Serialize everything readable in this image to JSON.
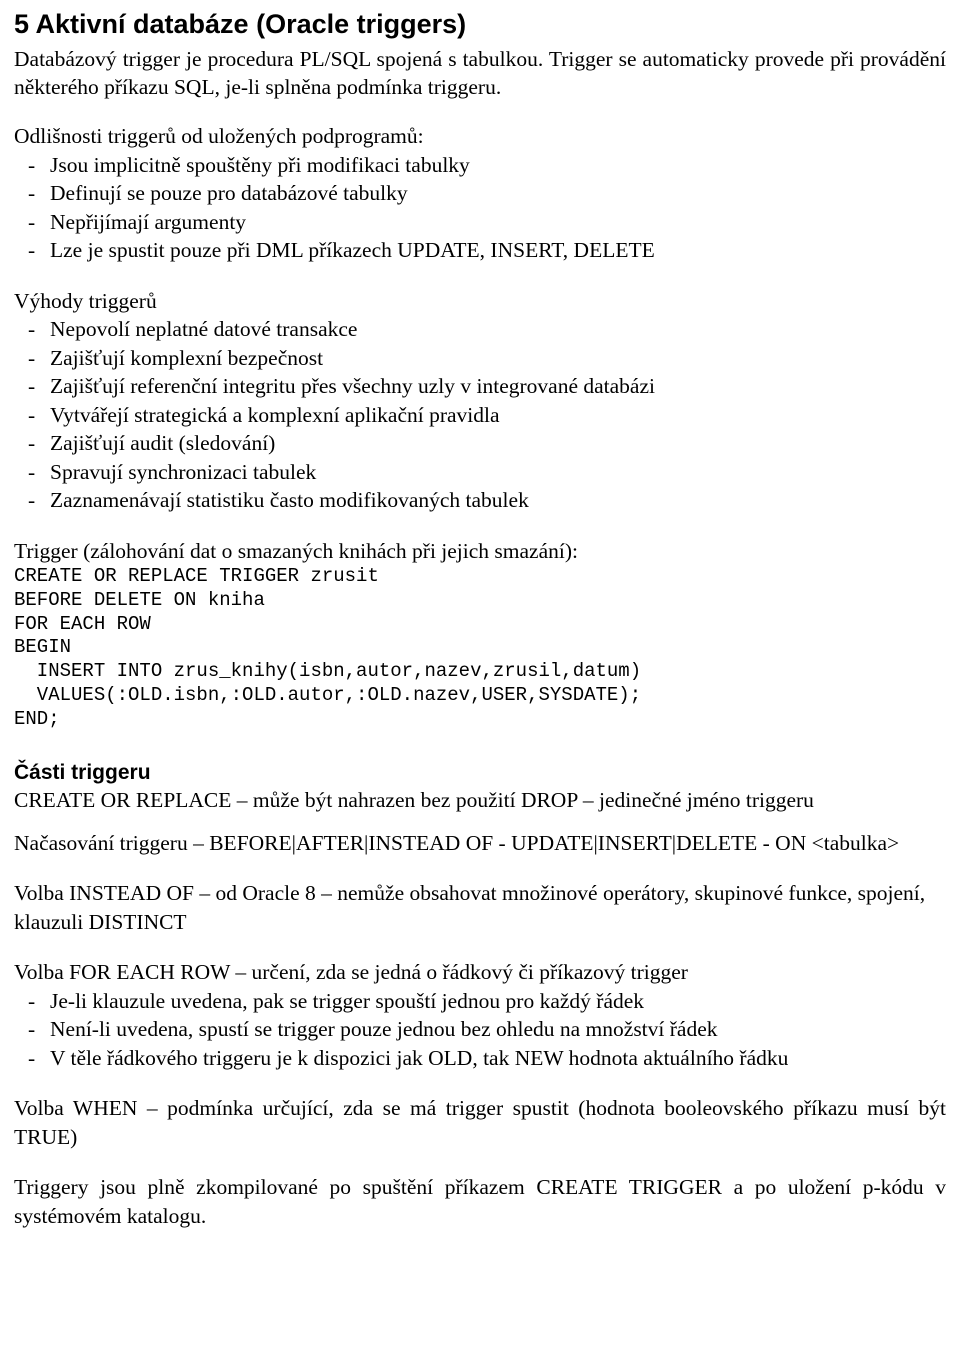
{
  "document": {
    "section_heading": "5 Aktivní databáze (Oracle triggers)",
    "intro_paragraph": "Databázový trigger je procedura PL/SQL spojená s tabulkou. Trigger se automaticky provede při provádění některého příkazu SQL, je-li splněna podmínka triggeru.",
    "differences": {
      "heading": "Odlišnosti triggerů od uložených podprogramů:",
      "items": [
        "Jsou implicitně spouštěny při modifikaci tabulky",
        "Definují se pouze pro databázové tabulky",
        "Nepřijímají argumenty",
        "Lze je spustit pouze při DML příkazech UPDATE, INSERT, DELETE"
      ]
    },
    "advantages": {
      "heading": "Výhody triggerů",
      "items": [
        "Nepovolí neplatné datové transakce",
        "Zajišťují komplexní bezpečnost",
        "Zajišťují referenční integritu přes všechny uzly v integrované databázi",
        "Vytvářejí strategická a komplexní aplikační pravidla",
        "Zajišťují audit (sledování)",
        "Spravují synchronizaci tabulek",
        "Zaznamenávají statistiku často modifikovaných tabulek"
      ]
    },
    "example": {
      "caption": "Trigger (zálohování dat o smazaných knihách při jejich smazání):",
      "code": "CREATE OR REPLACE TRIGGER zrusit\nBEFORE DELETE ON kniha\nFOR EACH ROW\nBEGIN\n  INSERT INTO zrus_knihy(isbn,autor,nazev,zrusil,datum)\n  VALUES(:OLD.isbn,:OLD.autor,:OLD.nazev,USER,SYSDATE);\nEND;"
    },
    "parts": {
      "heading": "Části triggeru",
      "p1": "CREATE OR REPLACE – může být nahrazen bez použití DROP – jedinečné jméno triggeru",
      "p2": "Načasování triggeru – BEFORE|AFTER|INSTEAD OF - UPDATE|INSERT|DELETE - ON <tabulka>",
      "p3": "Volba INSTEAD OF – od Oracle 8 – nemůže obsahovat množinové operátory, skupinové funkce, spojení, klauzuli DISTINCT",
      "p4": "Volba FOR EACH ROW – určení, zda se jedná o řádkový či příkazový trigger",
      "p4_items": [
        "Je-li klauzule uvedena, pak se trigger spouští jednou pro každý řádek",
        "Není-li uvedena, spustí se trigger pouze jednou bez ohledu na množství řádek",
        "V těle řádkového triggeru je k dispozici jak OLD, tak NEW hodnota aktuálního řádku"
      ],
      "p5": "Volba WHEN – podmínka určující, zda se má trigger spustit (hodnota booleovského příkazu musí být TRUE)",
      "p6": "Triggery jsou plně zkompilované po spuštění příkazem CREATE TRIGGER a po uložení p-kódu v systémovém katalogu."
    }
  }
}
